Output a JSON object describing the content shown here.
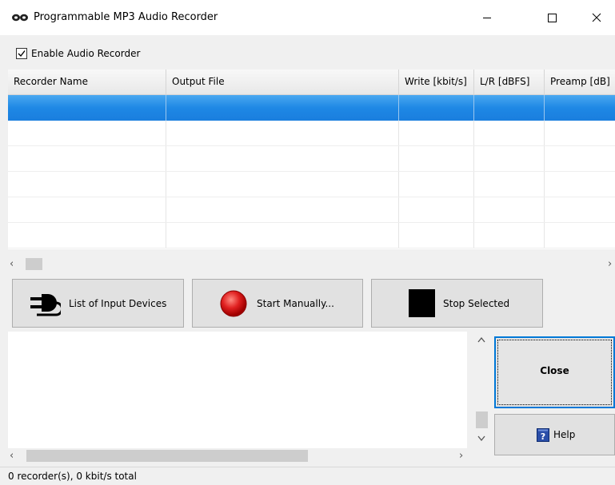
{
  "window": {
    "title": "Programmable MP3 Audio Recorder"
  },
  "enable_checkbox": {
    "label": "Enable Audio Recorder",
    "checked": true
  },
  "grid": {
    "columns": [
      "Recorder Name",
      "Output File",
      "Write [kbit/s]",
      "L/R [dBFS]",
      "Preamp [dB]"
    ],
    "rows": [
      {
        "selected": true
      },
      {
        "selected": false
      },
      {
        "selected": false
      },
      {
        "selected": false
      },
      {
        "selected": false
      },
      {
        "selected": false
      }
    ]
  },
  "buttons": {
    "list_devices": "List of Input Devices",
    "start_manually": "Start Manually...",
    "stop_selected": "Stop Selected",
    "close": "Close",
    "help": "Help"
  },
  "status_bar": {
    "text": "0 recorder(s), 0 kbit/s total"
  },
  "colors": {
    "selection": "#1e88e5",
    "focus_border": "#0078d7",
    "record_red": "#e02020"
  }
}
